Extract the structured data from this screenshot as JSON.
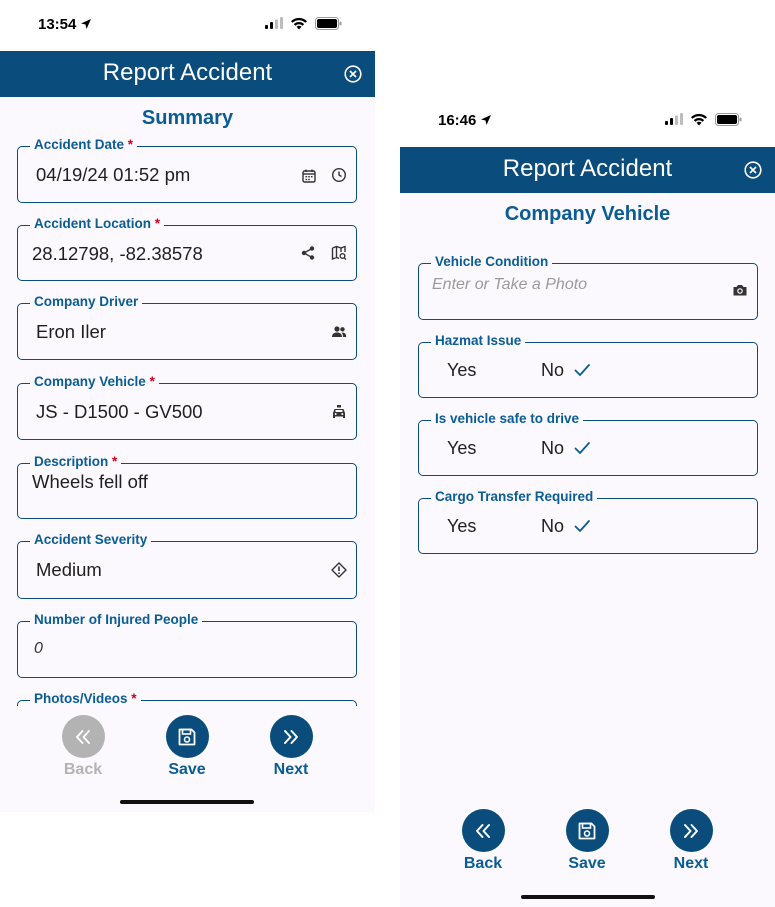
{
  "screen1": {
    "status": {
      "time": "13:54"
    },
    "header": {
      "title": "Report Accident"
    },
    "section_title": "Summary",
    "fields": {
      "accident_date": {
        "label": "Accident Date",
        "required": "*",
        "value": "04/19/24 01:52 pm"
      },
      "accident_location": {
        "label": "Accident Location",
        "required": "*",
        "value": "28.12798, -82.38578"
      },
      "company_driver": {
        "label": "Company Driver",
        "value": "Eron Iler"
      },
      "company_vehicle": {
        "label": "Company Vehicle",
        "required": "*",
        "value": "JS - D1500 - GV500"
      },
      "description": {
        "label": "Description",
        "required": "*",
        "value": "Wheels fell off"
      },
      "accident_severity": {
        "label": "Accident Severity",
        "value": "Medium"
      },
      "injured_people": {
        "label": "Number of Injured People",
        "value": "0"
      },
      "photos_videos": {
        "label": "Photos/Videos",
        "required": "*"
      }
    },
    "footer": {
      "back": "Back",
      "save": "Save",
      "next": "Next"
    }
  },
  "screen2": {
    "status": {
      "time": "16:46"
    },
    "header": {
      "title": "Report Accident"
    },
    "section_title": "Company Vehicle",
    "fields": {
      "vehicle_condition": {
        "label": "Vehicle Condition",
        "placeholder": "Enter or Take a Photo"
      },
      "hazmat_issue": {
        "label": "Hazmat Issue",
        "yes": "Yes",
        "no": "No",
        "selected": "No"
      },
      "safe_to_drive": {
        "label": "Is vehicle safe to drive",
        "yes": "Yes",
        "no": "No",
        "selected": "No"
      },
      "cargo_transfer": {
        "label": "Cargo Transfer Required",
        "yes": "Yes",
        "no": "No",
        "selected": "No"
      }
    },
    "footer": {
      "back": "Back",
      "save": "Save",
      "next": "Next"
    }
  },
  "icons": {
    "close": "close-circle-icon",
    "calendar": "calendar-icon",
    "clock": "clock-icon",
    "share": "share-icon",
    "map_search": "map-search-icon",
    "people": "people-icon",
    "car": "car-icon",
    "warning": "warning-diamond-icon",
    "camera": "camera-icon",
    "check": "checkmark-icon",
    "back": "double-chevron-left-icon",
    "save": "floppy-disk-icon",
    "next": "double-chevron-right-icon"
  },
  "colors": {
    "header_bg": "#0a4c7c",
    "accent": "#0a5c94",
    "required": "#d0021b",
    "disabled": "#b3b3b3"
  }
}
